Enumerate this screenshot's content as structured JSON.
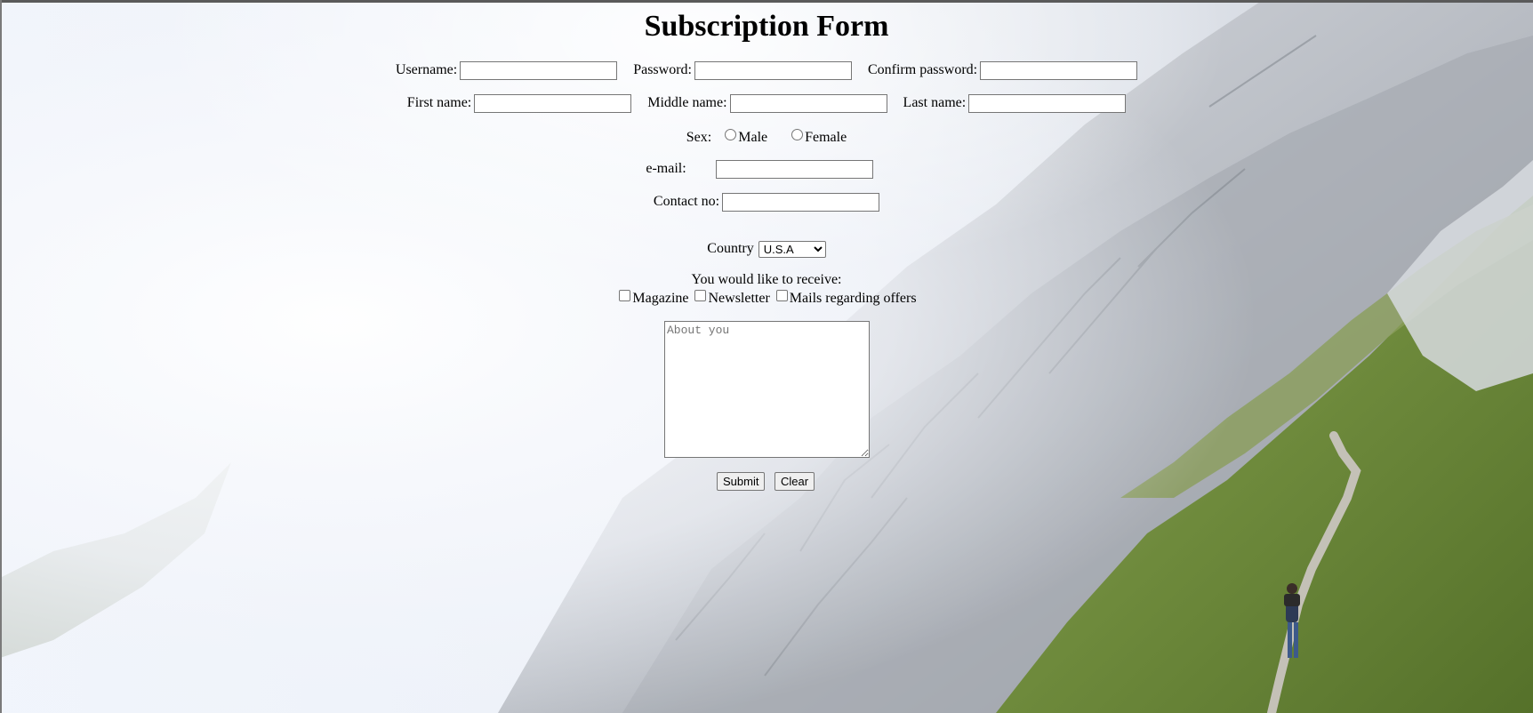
{
  "form": {
    "title": "Subscription Form",
    "username_label": "Username:",
    "username_value": "",
    "password_label": "Password:",
    "password_value": "",
    "confirm_password_label": "Confirm password:",
    "confirm_password_value": "",
    "first_name_label": "First name:",
    "first_name_value": "",
    "middle_name_label": "Middle name:",
    "middle_name_value": "",
    "last_name_label": "Last name:",
    "last_name_value": "",
    "sex_label": "Sex:",
    "sex_options": [
      "Male",
      "Female"
    ],
    "email_label": "e-mail:",
    "email_value": "",
    "contact_label": "Contact no:",
    "contact_value": "",
    "country_label": "Country",
    "country_selected": "U.S.A",
    "receive_label": "You would like to receive:",
    "receive_options": [
      "Magazine",
      "Newsletter",
      "Mails regarding offers"
    ],
    "about_placeholder": "About you",
    "submit_label": "Submit",
    "clear_label": "Clear"
  },
  "colors": {
    "page_background": "#eef3fb",
    "input_border": "#767676",
    "button_background": "#efefef"
  },
  "background_image": "misty-mountain-slope-with-hiker"
}
